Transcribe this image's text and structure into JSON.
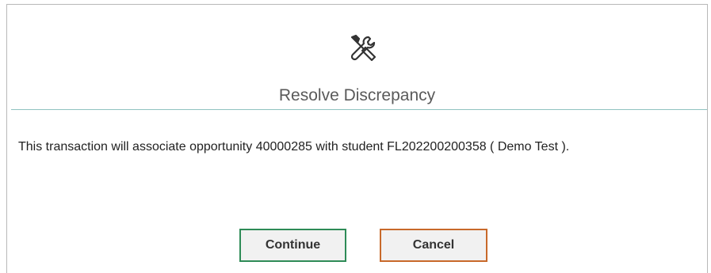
{
  "dialog": {
    "icon": "tools-icon",
    "title": "Resolve Discrepancy",
    "message": "This transaction will associate opportunity 40000285 with student FL202200200358 ( Demo Test ).",
    "buttons": {
      "continue_label": "Continue",
      "cancel_label": "Cancel"
    },
    "colors": {
      "continue_border": "#2e8b57",
      "cancel_border": "#c8692a",
      "divider": "#8fc3c0"
    }
  }
}
